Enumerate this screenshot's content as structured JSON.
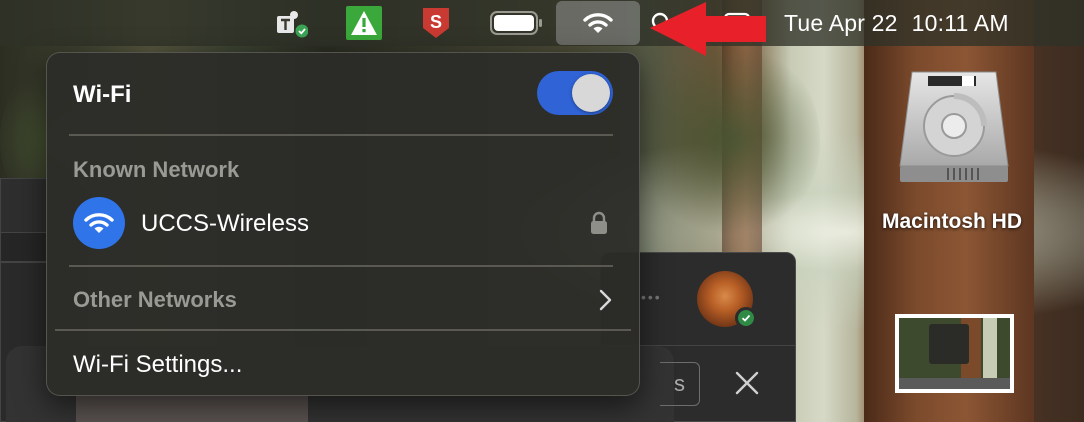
{
  "menubar": {
    "clock_date": "Tue Apr 22",
    "clock_time": "10:11 AM",
    "icons": [
      "teams-icon",
      "alert-triangle-icon",
      "s-shield-icon",
      "battery-icon",
      "wifi-icon",
      "search-icon",
      "control-center-icon"
    ]
  },
  "wifi_menu": {
    "title": "Wi-Fi",
    "toggle_on": true,
    "known_header": "Known Network",
    "known_networks": [
      {
        "name": "UCCS-Wireless",
        "secured": true
      }
    ],
    "other_header": "Other Networks",
    "settings_label": "Wi-Fi Settings..."
  },
  "background_window": {
    "button_fragment": "s"
  },
  "desktop": {
    "hd_label": "Macintosh HD"
  },
  "colors": {
    "toggle_on": "#2f63d6",
    "wifi_circle": "#2f74e8",
    "annotation_arrow": "#e8202a",
    "alert_green": "#3aa83a",
    "shield_red": "#c93a32"
  }
}
